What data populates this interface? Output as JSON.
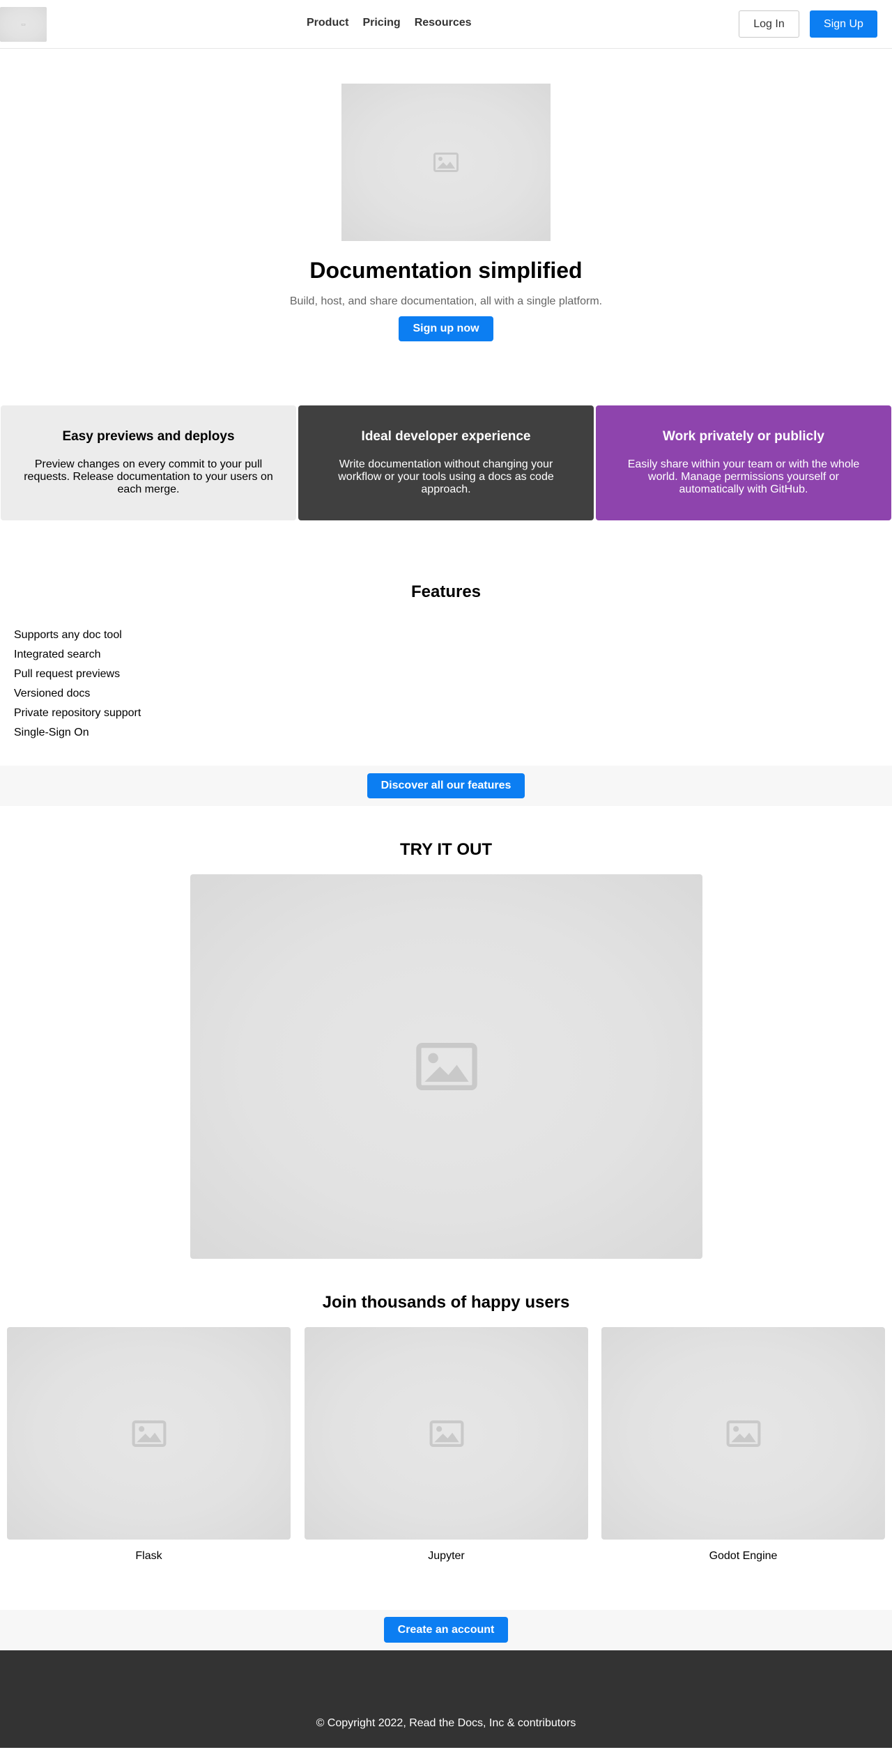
{
  "colors": {
    "accent": "#0c7ef2",
    "card_light": "#ececec",
    "card_dark": "#404040",
    "card_purple": "#8e44ad",
    "footer": "#333333",
    "band": "#f7f7f7"
  },
  "nav": {
    "logo_icon": "image-placeholder-icon",
    "links": [
      "Product",
      "Pricing",
      "Resources"
    ],
    "login_label": "Log In",
    "signup_label": "Sign Up"
  },
  "hero": {
    "image_icon": "image-placeholder-icon",
    "title": "Documentation simplified",
    "subtitle": "Build, host, and share documentation, all with a single platform.",
    "cta_label": "Sign up now"
  },
  "cards": [
    {
      "title": "Easy previews and deploys",
      "text": "Preview changes on every commit to your pull requests. Release documentation to your users on each merge."
    },
    {
      "title": "Ideal developer experience",
      "text": "Write documentation without changing your workflow or your tools using a docs as code approach."
    },
    {
      "title": "Work privately or publicly",
      "text": "Easily share within your team or with the whole world. Manage permissions yourself or automatically with GitHub."
    }
  ],
  "features": {
    "title": "Features",
    "items": [
      "Supports any doc tool",
      "Integrated search",
      "Pull request previews",
      "Versioned docs",
      "Private repository support",
      "Single-Sign On"
    ],
    "cta_label": "Discover all our features"
  },
  "try_it": {
    "title": "TRY IT OUT",
    "image_icon": "image-placeholder-icon"
  },
  "users": {
    "title": "Join thousands of happy users",
    "items": [
      {
        "name": "Flask",
        "image_icon": "image-placeholder-icon"
      },
      {
        "name": "Jupyter",
        "image_icon": "image-placeholder-icon"
      },
      {
        "name": "Godot Engine",
        "image_icon": "image-placeholder-icon"
      }
    ]
  },
  "cta": {
    "label": "Create an account"
  },
  "footer": {
    "copyright": "© Copyright 2022, Read the Docs, Inc & contributors"
  }
}
